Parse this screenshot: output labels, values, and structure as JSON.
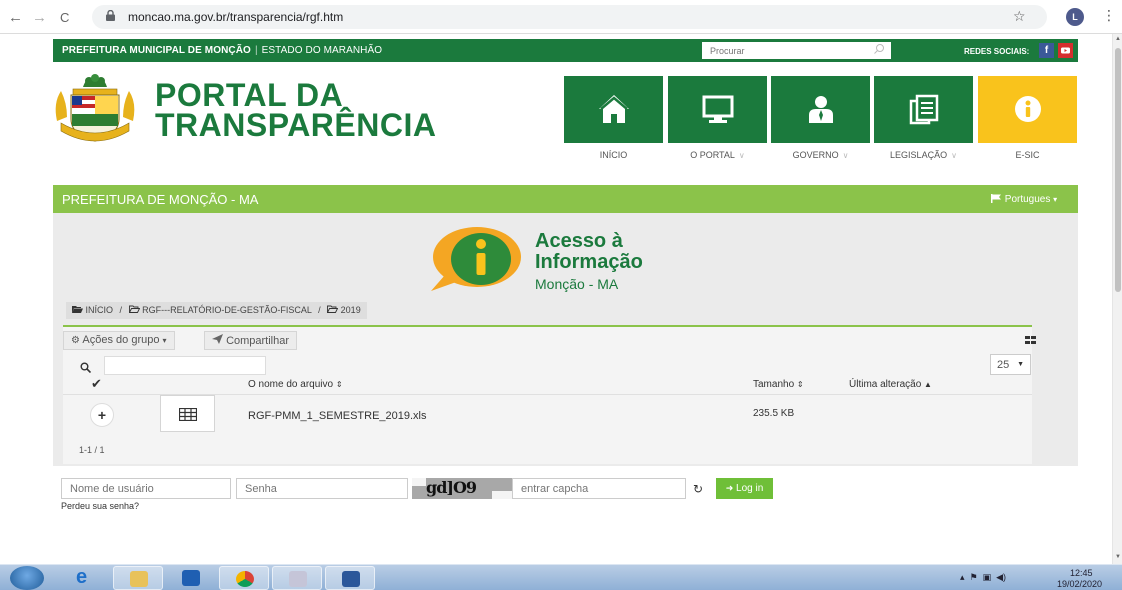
{
  "browser": {
    "url": "moncao.ma.gov.br/transparencia/rgf.htm",
    "back": "←",
    "forward": "→",
    "reload": "C",
    "star": "☆",
    "avatar": "L",
    "menu": "⋮"
  },
  "topbar": {
    "brand": "PREFEITURA MUNICIPAL DE MONÇÃO",
    "separator": "|",
    "state": "ESTADO DO MARANHÃO",
    "search_placeholder": "Procurar",
    "social_label": "REDES SOCIAIS:",
    "facebook": "f"
  },
  "logo": {
    "line1": "PORTAL DA",
    "line2": "TRANSPARÊNCIA"
  },
  "menu": {
    "items": [
      {
        "label": "INÍCIO",
        "icon": "home-icon"
      },
      {
        "label": "O PORTAL",
        "icon": "monitor-icon",
        "has_dropdown": true
      },
      {
        "label": "GOVERNO",
        "icon": "person-icon",
        "has_dropdown": true
      },
      {
        "label": "LEGISLAÇÃO",
        "icon": "documents-icon",
        "has_dropdown": true
      },
      {
        "label": "E-SIC",
        "icon": "info-icon"
      }
    ],
    "chevron": "∨"
  },
  "banner": {
    "title": "PREFEITURA DE MONÇÃO - MA",
    "language": "Portugues"
  },
  "info": {
    "title_line1": "Acesso à",
    "title_line2": "Informação",
    "subtitle": "Monção - MA"
  },
  "breadcrumb": {
    "home": "INÍCIO",
    "folder1": "RGF---RELATÓRIO-DE-GESTÃO-FISCAL",
    "folder2": "2019",
    "separator": "/"
  },
  "toolbar": {
    "group_actions": "Ações do grupo",
    "share": "Compartilhar"
  },
  "filter": {
    "per_page": "25"
  },
  "table": {
    "headers": {
      "name": "O nome do arquivo",
      "size": "Tamanho",
      "modified": "Última alteração"
    },
    "rows": [
      {
        "name": "RGF-PMM_1_SEMESTRE_2019.xls",
        "size": "235.5 KB",
        "modified": ""
      }
    ],
    "pager": "1-1 / 1"
  },
  "login": {
    "username_placeholder": "Nome de usuário",
    "password_placeholder": "Senha",
    "captcha_text": "gd]O9",
    "captcha_placeholder": "entrar capcha",
    "button": "Log in",
    "lost_password": "Perdeu sua senha?"
  },
  "taskbar": {
    "time": "12:45",
    "date": "19/02/2020"
  }
}
